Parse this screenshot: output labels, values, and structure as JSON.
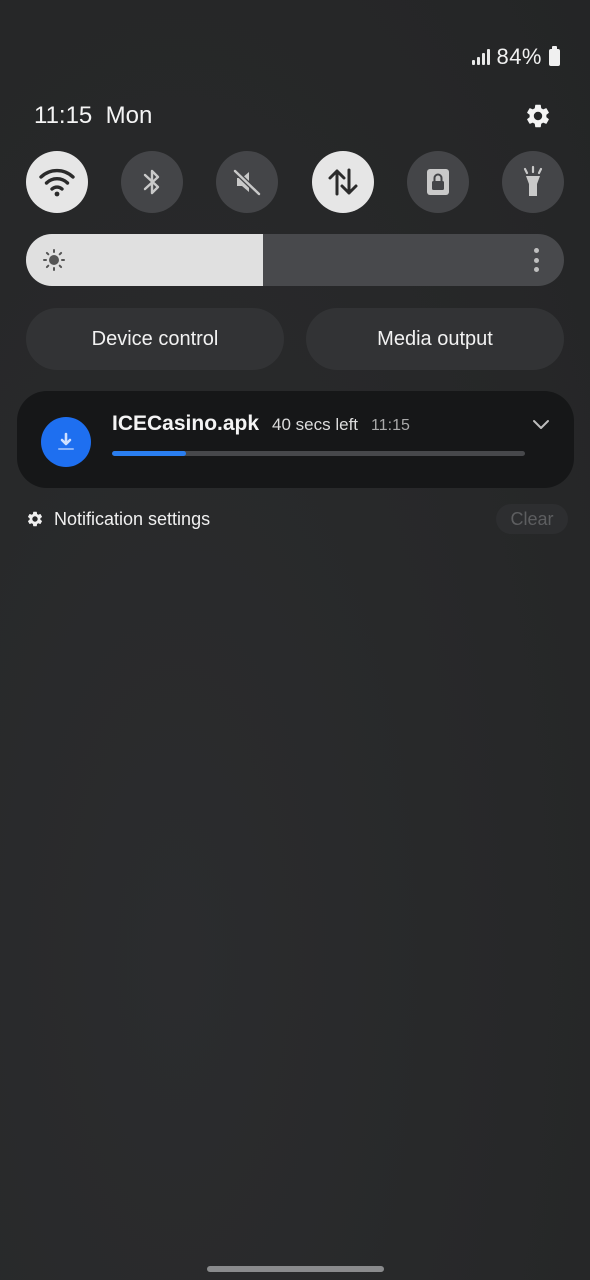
{
  "status_bar": {
    "battery_percent": "84%",
    "signal_level": 4
  },
  "header": {
    "clock": "11:15  Mon",
    "settings_icon": "gear-icon"
  },
  "quick_toggles": [
    {
      "name": "wifi",
      "icon": "wifi-icon",
      "state": "on"
    },
    {
      "name": "bluetooth",
      "icon": "bluetooth-icon",
      "state": "off"
    },
    {
      "name": "sound",
      "icon": "mute-icon",
      "state": "off"
    },
    {
      "name": "mobile-data",
      "icon": "data-transfer-icon",
      "state": "on"
    },
    {
      "name": "screen-lock",
      "icon": "lock-icon",
      "state": "off"
    },
    {
      "name": "flashlight",
      "icon": "flashlight-icon",
      "state": "off"
    }
  ],
  "brightness": {
    "level": 0.44,
    "icon": "sun-icon"
  },
  "pills": {
    "device_control": "Device control",
    "media_output": "Media output"
  },
  "notification": {
    "icon": "download-icon",
    "file_name": "ICECasino.apk",
    "time_left": "40 secs left",
    "time": "11:15",
    "progress": 0.18,
    "expand_icon": "chevron-down-icon"
  },
  "footer": {
    "notification_settings": "Notification settings",
    "clear": "Clear"
  },
  "colors": {
    "accent": "#1e6ff0",
    "progress": "#2a7ef0",
    "toggle_on": "#e6e6e6",
    "toggle_off": "#444548"
  }
}
